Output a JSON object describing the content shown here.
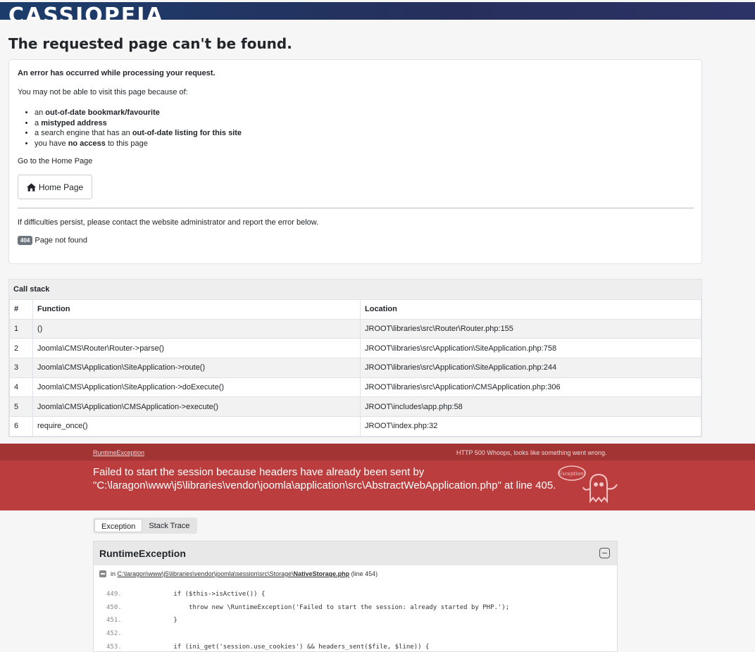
{
  "header": {
    "brand": "CASSIOPEIA"
  },
  "page_title": "The requested page can't be found.",
  "error_card": {
    "heading": "An error has occurred while processing your request.",
    "intro": "You may not be able to visit this page because of:",
    "reasons": [
      {
        "prefix": "an ",
        "bold": "out-of-date bookmark/favourite",
        "suffix": ""
      },
      {
        "prefix": "a ",
        "bold": "mistyped address",
        "suffix": ""
      },
      {
        "prefix": "a search engine that has an ",
        "bold": "out-of-date listing for this site",
        "suffix": ""
      },
      {
        "prefix": "you have ",
        "bold": "no access",
        "suffix": " to this page"
      }
    ],
    "go_home_text": "Go to the Home Page",
    "home_button_label": "Home Page",
    "contact_text": "If difficulties persist, please contact the website administrator and report the error below.",
    "error_code": "404",
    "error_message": "Page not found"
  },
  "call_stack": {
    "caption": "Call stack",
    "headers": [
      "#",
      "Function",
      "Location"
    ],
    "rows": [
      {
        "n": "1",
        "function": "()",
        "location": "JROOT\\libraries\\src\\Router\\Router.php:155"
      },
      {
        "n": "2",
        "function": "Joomla\\CMS\\Router\\Router->parse()",
        "location": "JROOT\\libraries\\src\\Application\\SiteApplication.php:758"
      },
      {
        "n": "3",
        "function": "Joomla\\CMS\\Application\\SiteApplication->route()",
        "location": "JROOT\\libraries\\src\\Application\\SiteApplication.php:244"
      },
      {
        "n": "4",
        "function": "Joomla\\CMS\\Application\\SiteApplication->doExecute()",
        "location": "JROOT\\libraries\\src\\Application\\CMSApplication.php:306"
      },
      {
        "n": "5",
        "function": "Joomla\\CMS\\Application\\CMSApplication->execute()",
        "location": "JROOT\\includes\\app.php:58"
      },
      {
        "n": "6",
        "function": "require_once()",
        "location": "JROOT\\index.php:32"
      }
    ]
  },
  "whoops": {
    "exception_class": "RuntimeException",
    "http_status": "HTTP 500",
    "http_text": "Whoops, looks like something went wrong.",
    "message": "Failed to start the session because headers have already been sent by \"C:\\laragon\\www\\j5\\libraries\\vendor\\joomla\\application\\src\\AbstractWebApplication.php\" at line 405.",
    "ghost_label": "Exception!",
    "tabs": [
      "Exception",
      "Stack Trace"
    ],
    "panel_title": "RuntimeException",
    "frame_prefix": "in ",
    "frame_path": "C:\\laragon\\www\\j5\\libraries\\vendor\\joomla\\session\\src\\Storage\\",
    "frame_file": "NativeStorage.php",
    "frame_line": " (line 454)",
    "code_lines": [
      {
        "ln": "449.",
        "src": "        if ($this->isActive()) {"
      },
      {
        "ln": "450.",
        "src": "            throw new \\RuntimeException('Failed to start the session: already started by PHP.');"
      },
      {
        "ln": "451.",
        "src": "        }"
      },
      {
        "ln": "452.",
        "src": ""
      },
      {
        "ln": "453.",
        "src": "        if (ini_get('session.use_cookies') && headers_sent($file, $line)) {"
      }
    ]
  }
}
